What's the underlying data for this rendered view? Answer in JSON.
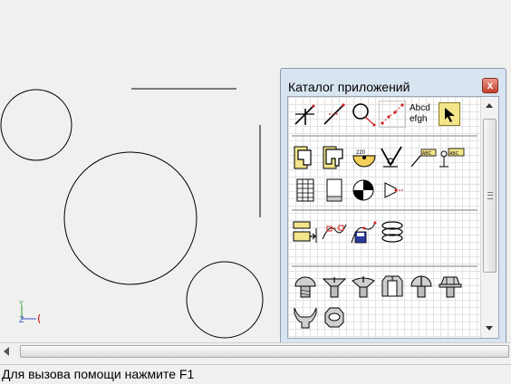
{
  "palette": {
    "title": "Каталог приложений",
    "close_label": "x",
    "text_tool": {
      "line1": "Abcd",
      "line2": "efgh"
    },
    "icons": {
      "row1": [
        "line-angle-icon",
        "line-red-endpoint-icon",
        "circle-tangent-icon",
        "spline-points-icon",
        "text-style-icon",
        "arrow-select-icon"
      ],
      "row2": [
        "dimension-linear-icon",
        "dimension-frame-icon",
        "angle-dim-icon",
        "weld-sign-icon",
        "leader-text-icon",
        "leader-text-2-icon"
      ],
      "row3": [
        "table-icon",
        "sheet-icon",
        "center-mark-icon",
        "view-arrow-icon"
      ],
      "row4": [
        "insert-block-icon",
        "polyline-edit-icon",
        "spline-save-icon",
        "spring-icon"
      ],
      "row5": [
        "screw-round-icon",
        "screw-countersunk-icon",
        "screw-raised-icon",
        "bolt-hex-icon",
        "screw-pan-icon",
        "bolt-flange-icon"
      ],
      "row6": [
        "wing-nut-icon",
        "nut-hex-icon"
      ]
    }
  },
  "status": {
    "text": "Для вызова помощи нажмите F1"
  },
  "axis": {
    "z_label": "Z",
    "y_label": "Y"
  },
  "colors": {
    "canvas": "#f0f0ee",
    "stroke": "#000000",
    "accent_red": "#d22020"
  }
}
